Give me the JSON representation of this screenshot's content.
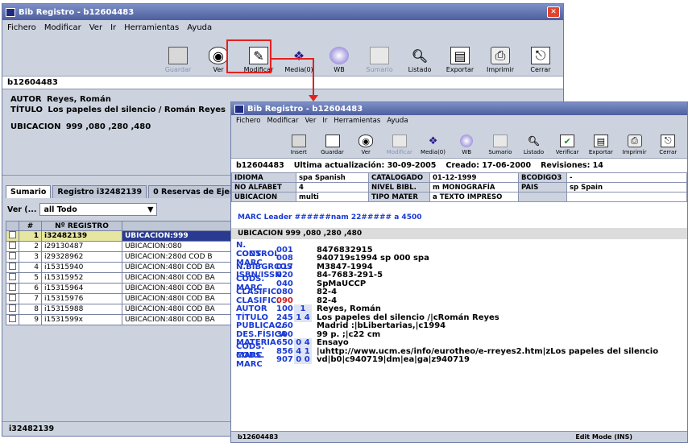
{
  "back_window": {
    "title": "Bib Registro - b12604483",
    "menu": [
      "Fichero",
      "Modificar",
      "Ver",
      "Ir",
      "Herramientas",
      "Ayuda"
    ],
    "toolbar": [
      {
        "label": "Guardar",
        "icon": "save-icon",
        "disabled": true
      },
      {
        "label": "Ver",
        "icon": "view-icon",
        "disabled": false
      },
      {
        "label": "Modificar",
        "icon": "edit-icon",
        "disabled": false
      },
      {
        "label": "Media(0)",
        "icon": "media-icon",
        "disabled": false
      },
      {
        "label": "WB",
        "icon": "globe-icon",
        "disabled": false
      },
      {
        "label": "Sumario",
        "icon": "summary-icon",
        "disabled": true
      },
      {
        "label": "Listado",
        "icon": "search-icon",
        "disabled": false
      },
      {
        "label": "Exportar",
        "icon": "export-icon",
        "disabled": false
      },
      {
        "label": "Imprimir",
        "icon": "print-icon",
        "disabled": false
      },
      {
        "label": "Cerrar",
        "icon": "close-icon",
        "disabled": false
      }
    ],
    "record_id": "b12604483",
    "autor_label": "AUTOR",
    "autor_value": "Reyes, Román",
    "titulo_label": "TÍTULO",
    "titulo_value": "Los papeles del silencio / Román Reyes",
    "ubicacion_label": "UBICACION",
    "ubicacion_value": "999 ,080 ,280 ,480",
    "tabs": [
      "Sumario",
      "Registro i32482139",
      "0 Reservas de Ejer"
    ],
    "ver_label": "Ver (...",
    "ver_select": "all Todo",
    "table_headers": [
      "#",
      "Nº REGISTRO",
      ""
    ],
    "rows": [
      {
        "n": "1",
        "reg": "i32482139",
        "ub": "UBICACION:999"
      },
      {
        "n": "2",
        "reg": "i29130487",
        "ub": "UBICACION:080"
      },
      {
        "n": "3",
        "reg": "i29328962",
        "ub": "UBICACION:280d COD B"
      },
      {
        "n": "4",
        "reg": "i15315940",
        "ub": "UBICACION:480I COD BA"
      },
      {
        "n": "5",
        "reg": "i15315952",
        "ub": "UBICACION:480I COD BA"
      },
      {
        "n": "6",
        "reg": "i15315964",
        "ub": "UBICACION:480I COD BA"
      },
      {
        "n": "7",
        "reg": "i15315976",
        "ub": "UBICACION:480I COD BA"
      },
      {
        "n": "8",
        "reg": "i15315988",
        "ub": "UBICACION:480I COD BA"
      },
      {
        "n": "9",
        "reg": "i1531599x",
        "ub": "UBICACION:480I COD BA"
      }
    ],
    "status": "i32482139"
  },
  "front_window": {
    "title": "Bib Registro - b12604483",
    "menu": [
      "Fichero",
      "Modificar",
      "Ver",
      "Ir",
      "Herramientas",
      "Ayuda"
    ],
    "toolbar": [
      {
        "label": "Insert",
        "disabled": false
      },
      {
        "label": "Guardar",
        "disabled": false
      },
      {
        "label": "Ver",
        "disabled": false
      },
      {
        "label": "Modificar",
        "disabled": true
      },
      {
        "label": "Media(0)",
        "disabled": false
      },
      {
        "label": "WB",
        "disabled": false
      },
      {
        "label": "Sumario",
        "disabled": false
      },
      {
        "label": "Listado",
        "disabled": false
      },
      {
        "label": "Verificar",
        "disabled": false
      },
      {
        "label": "Exportar",
        "disabled": false
      },
      {
        "label": "Imprimir",
        "disabled": false
      },
      {
        "label": "Cerrar",
        "disabled": false
      }
    ],
    "record_id": "b12604483",
    "ultima": "Ultima actualización: 30-09-2005",
    "creado": "Creado: 17-06-2000",
    "revisiones": "Revisiones: 14",
    "fixed": [
      [
        "IDIOMA",
        "spa  Spanish",
        "CATALOGADO",
        "01-12-1999",
        "BCODIGO3",
        "-"
      ],
      [
        "NO ALFABET",
        "4",
        "NIVEL BIBL.",
        "m  MONOGRAFÍA",
        "PAIS",
        "sp   Spain"
      ],
      [
        "UBICACION",
        "multi",
        "TIPO MATER",
        "a  TEXTO IMPRESO",
        "",
        ""
      ]
    ],
    "marc_leader": "MARC Leader   ######nam  22#####  a 4500",
    "ubicacion_line": "UBICACION   999 ,080 ,280 ,480",
    "marc": [
      {
        "label": "N. CONTROL",
        "tag": "001",
        "ind": "",
        "value": "8476832915"
      },
      {
        "label": "CODS. MARC",
        "tag": "008",
        "ind": "",
        "value": "940719s1994    sp         000  spa"
      },
      {
        "label": "N.BIBGRCOS",
        "tag": "017",
        "ind": "",
        "value": "M3847-1994"
      },
      {
        "label": "ISBN/ISSN",
        "tag": "020",
        "ind": "",
        "value": "84-7683-291-5"
      },
      {
        "label": "CODS. MARC",
        "tag": "040",
        "ind": "",
        "value": "SpMaUCCP"
      },
      {
        "label": "CLASIFIC.",
        "tag": "080",
        "ind": "",
        "value": "82-4"
      },
      {
        "label": "CLASIFIC.",
        "tag": "090",
        "ind": "",
        "value": "82-4"
      },
      {
        "label": "AUTOR",
        "tag": "100",
        "ind": "1",
        "value": "Reyes, Román"
      },
      {
        "label": "TÍTULO",
        "tag": "245",
        "ind": "1  4",
        "value": "Los papeles del silencio /|cRomán Reyes"
      },
      {
        "label": "PUBLICAC.",
        "tag": "260",
        "ind": "",
        "value": "Madrid :|bLibertarias,|c1994"
      },
      {
        "label": "DES.FÍSICA",
        "tag": "300",
        "ind": "",
        "value": "99 p. ;|c22 cm"
      },
      {
        "label": "MATERIA",
        "tag": "650",
        "ind": "0  4",
        "value": "Ensayo"
      },
      {
        "label": "CODS. MARC",
        "tag": "856",
        "ind": "4  1",
        "value": "|uhttp://www.ucm.es/info/eurotheo/e-rreyes2.htm|zLos papeles del silencio"
      },
      {
        "label": "CODS. MARC",
        "tag": "907",
        "ind": "0  0",
        "value": "vd|b0|c940719|dm|ea|ga|z940719"
      }
    ],
    "status_left": "b12604483",
    "status_right": "Edit Mode (INS)"
  }
}
